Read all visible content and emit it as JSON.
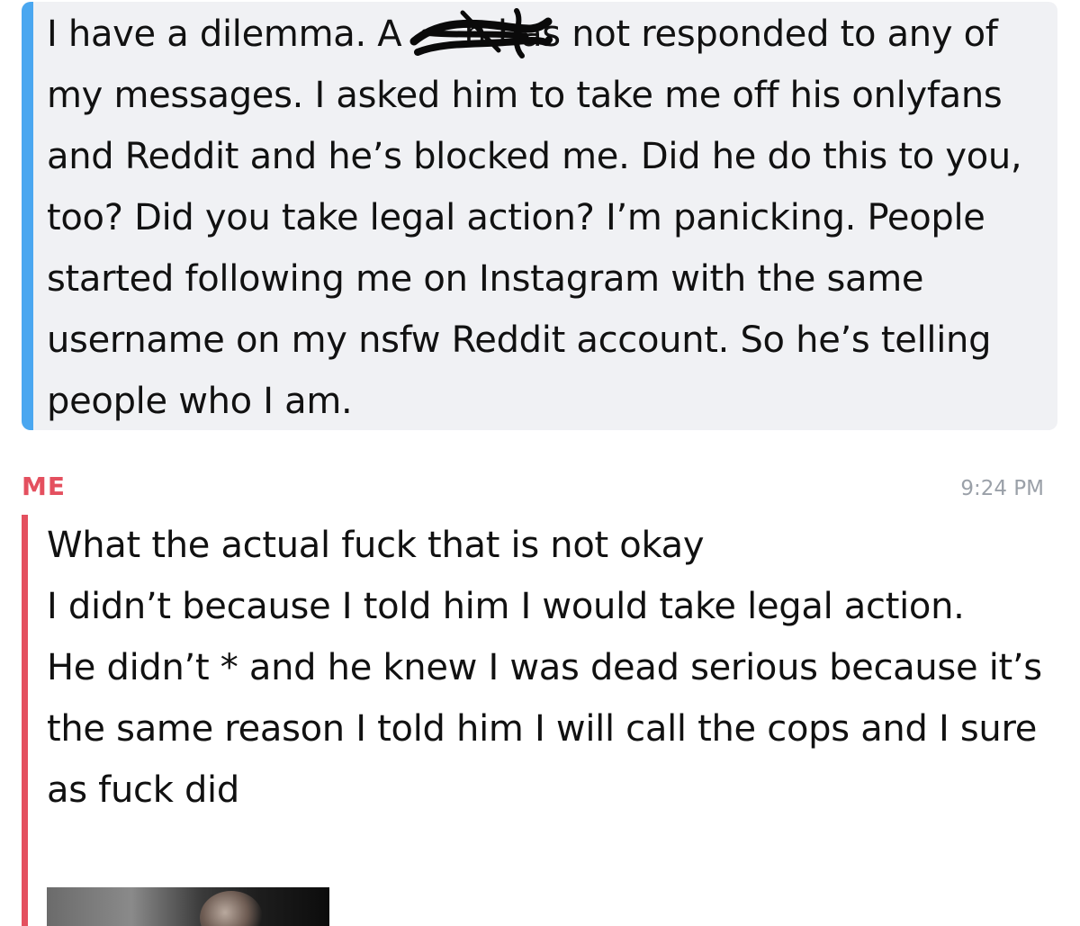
{
  "quoted_message": {
    "text": "I have a dilemma. A         n has not responded to any of my messages. I asked him to take me off his onlyfans and Reddit and he’s blocked me. Did he do this to you, too? Did you take legal action? I’m panicking. People started following me on Instagram with the same username on my nsfw Reddit account. So he’s telling people who I am.",
    "accent_color": "#4aa7f0",
    "background_color": "#f0f1f4"
  },
  "sender": {
    "label": "ME",
    "time": "9:24 PM",
    "color": "#e4505f"
  },
  "my_messages": [
    "What the actual fuck that is not okay",
    "I didn’t because I told him I would take legal action.",
    "He didn’t * and he knew I was dead serious because it’s the same reason I told him I will call the cops and I sure as fuck did"
  ],
  "attachment": {
    "kind": "photo-thumbnail"
  }
}
